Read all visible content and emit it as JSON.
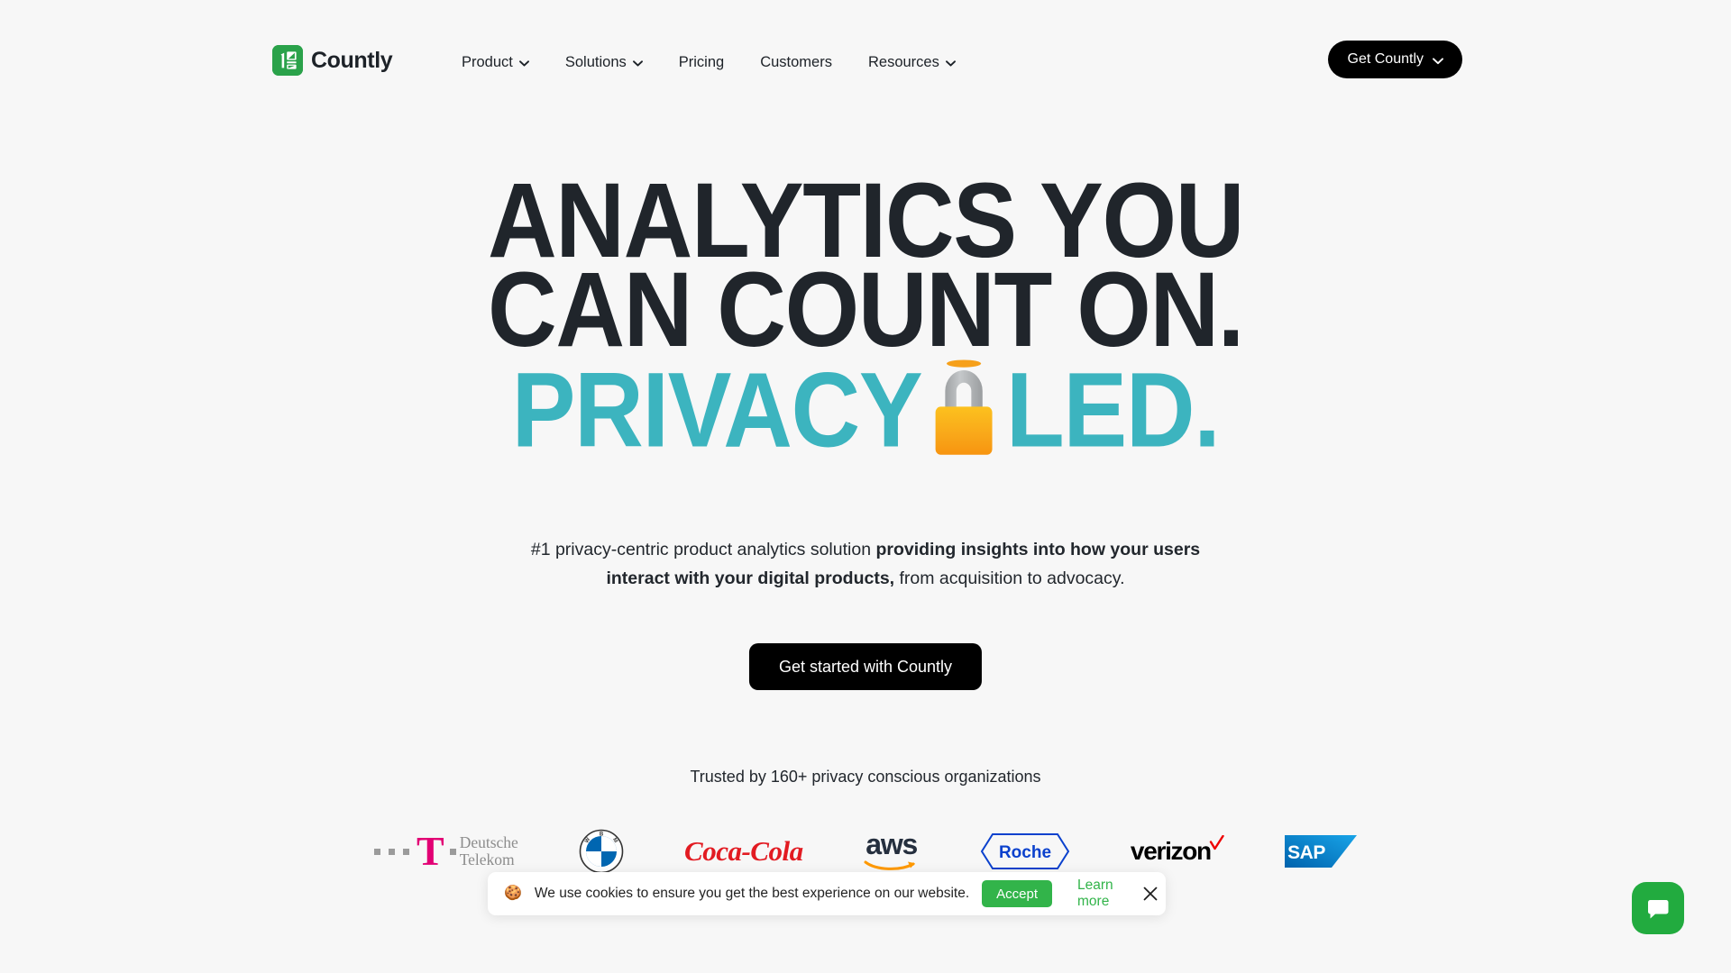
{
  "page": {
    "background": "#f7f7f7",
    "accent_teal": "#3cb4bf",
    "accent_green": "#32b44a",
    "text_dark": "#20252b"
  },
  "header": {
    "logo": {
      "name": "Countly",
      "mark_color": "#2aa24a"
    },
    "nav": [
      {
        "label": "Product",
        "has_dropdown": true
      },
      {
        "label": "Solutions",
        "has_dropdown": true
      },
      {
        "label": "Pricing",
        "has_dropdown": false
      },
      {
        "label": "Customers",
        "has_dropdown": false
      },
      {
        "label": "Resources",
        "has_dropdown": true
      }
    ],
    "cta": {
      "label": "Get Countly",
      "has_dropdown": true
    }
  },
  "hero": {
    "headline_line1": "ANALYTICS YOU",
    "headline_line2": "CAN COUNT ON.",
    "headline_line3_pre": "PRIVACY",
    "headline_line3_post": "LED.",
    "headline_emoji": "lock",
    "subtitle_part1": "#1 privacy-centric product analytics solution ",
    "subtitle_bold": "providing insights into how your users interact with your digital products,",
    "subtitle_part2": " from acquisition to advocacy.",
    "cta_label": "Get started with Countly",
    "trusted_label": "Trusted by 160+ privacy conscious organizations"
  },
  "logos": [
    {
      "name": "Deutsche Telekom",
      "line1": "Deutsche",
      "line2": "Telekom",
      "mark": "T",
      "color": "#e20074"
    },
    {
      "name": "BMW",
      "letters": "BMW",
      "color": "#0066b1"
    },
    {
      "name": "Coca-Cola",
      "wordmark": "Coca-Cola",
      "color": "#e21b22"
    },
    {
      "name": "aws",
      "wordmark": "aws",
      "color": "#252f3e",
      "accent": "#ff9900"
    },
    {
      "name": "Roche",
      "wordmark": "Roche",
      "color": "#0b41cd"
    },
    {
      "name": "verizon",
      "wordmark": "verizon",
      "color": "#000000",
      "accent": "#ee0000"
    },
    {
      "name": "SAP",
      "wordmark": "SAP",
      "color": "#008fd3"
    }
  ],
  "cookie_banner": {
    "emoji": "🍪",
    "message": "We use cookies to ensure you get the best experience on our website.",
    "accept_label": "Accept",
    "learn_more_label": "Learn more",
    "close_icon": "close-icon"
  },
  "chat_widget": {
    "icon": "chat-bubble-icon",
    "color": "#22ab3f"
  }
}
